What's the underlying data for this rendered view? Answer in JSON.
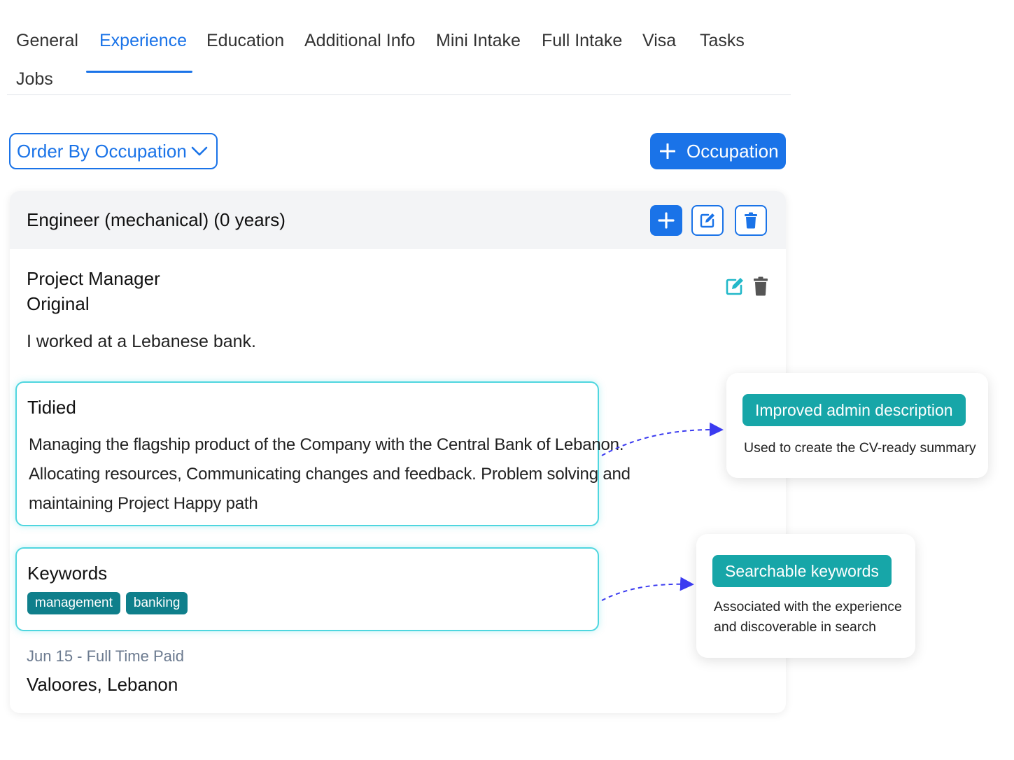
{
  "tabs": [
    {
      "label": "General"
    },
    {
      "label": "Experience"
    },
    {
      "label": "Education"
    },
    {
      "label": "Additional Info"
    },
    {
      "label": "Mini Intake"
    },
    {
      "label": "Full Intake"
    },
    {
      "label": "Visa"
    },
    {
      "label": "Tasks"
    },
    {
      "label": "Jobs"
    }
  ],
  "active_tab": "Experience",
  "toolbar": {
    "order_label": "Order By Occupation",
    "add_occupation_label": "Occupation"
  },
  "occupation": {
    "title": "Engineer (mechanical) (0 years)"
  },
  "experience": {
    "role": "Project Manager",
    "version_label": "Original",
    "original_description": "I worked at a Lebanese bank.",
    "tidied_title": "Tidied",
    "tidied_lines": [
      "Managing the flagship product of the Company with the Central Bank of Lebanon.",
      "Allocating resources, Communicating changes and feedback. Problem solving and",
      "maintaining Project Happy path"
    ],
    "keywords_title": "Keywords",
    "keywords": [
      "management",
      "banking"
    ],
    "date_line": "Jun 15 - Full Time Paid",
    "company_line": "Valoores, Lebanon"
  },
  "callouts": {
    "improved": {
      "badge": "Improved admin description",
      "text": "Used to create the CV-ready summary"
    },
    "keywords": {
      "badge": "Searchable keywords",
      "text": "Associated with the experience and discoverable in search"
    }
  },
  "colors": {
    "primary": "#1a73e8",
    "teal_badge": "#17a6a8",
    "keyword_tag": "#0f7f8b",
    "box_border": "#4fd6df",
    "edit_icon_teal": "#22b8c9"
  },
  "icons": {
    "chevron": "chevron-down-icon",
    "plus": "plus-icon",
    "edit": "edit-icon",
    "trash": "trash-icon"
  }
}
